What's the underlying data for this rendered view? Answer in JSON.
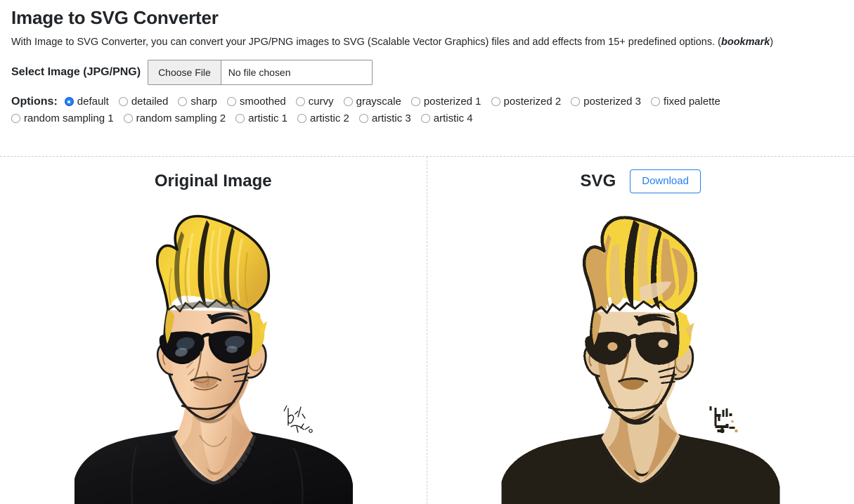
{
  "header": {
    "title": "Image to SVG Converter",
    "description_before": "With Image to SVG Converter, you can convert your JPG/PNG images to SVG (Scalable Vector Graphics) files and add effects from 15+ predefined options. (",
    "description_link": "bookmark",
    "description_after": ")"
  },
  "file_select": {
    "label": "Select Image (JPG/PNG)",
    "choose_button": "Choose File",
    "file_name": "No file chosen"
  },
  "options": {
    "label": "Options:",
    "selected": "default",
    "row1": [
      {
        "label": "default",
        "checked": true
      },
      {
        "label": "detailed",
        "checked": false
      },
      {
        "label": "sharp",
        "checked": false
      },
      {
        "label": "smoothed",
        "checked": false
      },
      {
        "label": "curvy",
        "checked": false
      },
      {
        "label": "grayscale",
        "checked": false
      },
      {
        "label": "posterized 1",
        "checked": false
      },
      {
        "label": "posterized 2",
        "checked": false
      },
      {
        "label": "posterized 3",
        "checked": false
      },
      {
        "label": "fixed palette",
        "checked": false
      }
    ],
    "row2": [
      {
        "label": "random sampling 1",
        "checked": false
      },
      {
        "label": "random sampling 2",
        "checked": false
      },
      {
        "label": "artistic 1",
        "checked": false
      },
      {
        "label": "artistic 2",
        "checked": false
      },
      {
        "label": "artistic 3",
        "checked": false
      },
      {
        "label": "artistic 4",
        "checked": false
      }
    ]
  },
  "panels": {
    "left": {
      "title": "Original Image",
      "image_alt": "cartoon portrait of a man with tall blond pompadour hair, black sunglasses and black t-shirt"
    },
    "right": {
      "title": "SVG",
      "download_button": "Download",
      "image_alt": "posterized vector version of the cartoon portrait"
    }
  },
  "colors": {
    "accent": "#2680eb",
    "text": "#212529",
    "divider": "#cfcfcf",
    "button_face": "#efefef",
    "hair_yellow": "#f7d13c",
    "hair_shadow": "#d9a84e",
    "skin": "#f2c9a0",
    "skin_shadow": "#cf9f70",
    "shirt_black": "#161616",
    "svg_hair_yellow": "#f5d33e",
    "svg_hair_tan": "#d3a45c",
    "svg_skin": "#edd0a8",
    "svg_skin_shadow": "#cba06a",
    "svg_shirt": "#231f17"
  }
}
